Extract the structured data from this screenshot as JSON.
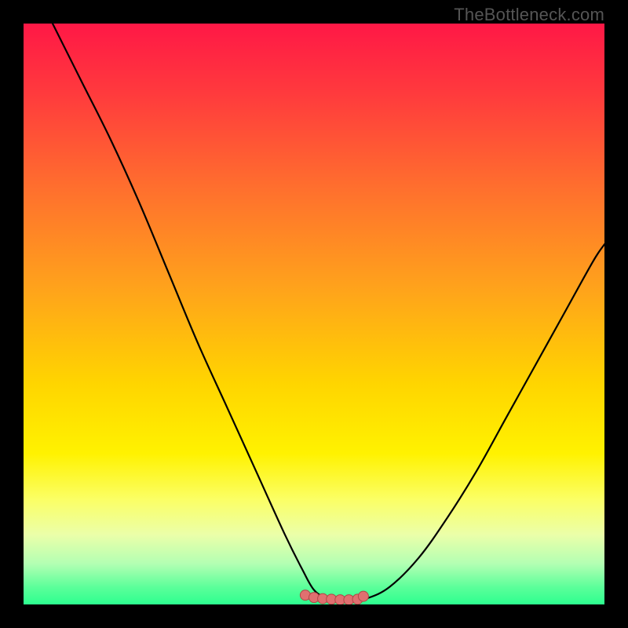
{
  "watermark": "TheBottleneck.com",
  "colors": {
    "frame": "#000000",
    "curve": "#000000",
    "marker_fill": "#e07070",
    "marker_stroke": "#b04848",
    "gradient_stops": [
      {
        "offset": 0.0,
        "color": "#ff1846"
      },
      {
        "offset": 0.12,
        "color": "#ff3a3d"
      },
      {
        "offset": 0.28,
        "color": "#ff6e2e"
      },
      {
        "offset": 0.45,
        "color": "#ffa11c"
      },
      {
        "offset": 0.62,
        "color": "#ffd500"
      },
      {
        "offset": 0.74,
        "color": "#fff200"
      },
      {
        "offset": 0.82,
        "color": "#fbff66"
      },
      {
        "offset": 0.88,
        "color": "#ebffa9"
      },
      {
        "offset": 0.93,
        "color": "#b3ffb3"
      },
      {
        "offset": 0.97,
        "color": "#5cff9a"
      },
      {
        "offset": 1.0,
        "color": "#2dff8f"
      }
    ]
  },
  "chart_data": {
    "type": "line",
    "title": "",
    "xlabel": "",
    "ylabel": "",
    "xlim": [
      0,
      100
    ],
    "ylim": [
      0,
      100
    ],
    "series": [
      {
        "name": "bottleneck-curve",
        "x": [
          5,
          10,
          15,
          20,
          25,
          30,
          35,
          40,
          45,
          48,
          50,
          52,
          55,
          57,
          59,
          63,
          68,
          73,
          78,
          83,
          88,
          93,
          98,
          100
        ],
        "y": [
          100,
          90,
          80,
          69,
          57,
          45,
          34,
          23,
          12,
          6,
          2.5,
          1.3,
          0.8,
          0.8,
          1.0,
          3.0,
          8,
          15,
          23,
          32,
          41,
          50,
          59,
          62
        ]
      }
    ],
    "markers": {
      "name": "optimal-range",
      "x": [
        48.5,
        50.0,
        51.5,
        53.0,
        54.5,
        56.0,
        57.5,
        58.5
      ],
      "y": [
        1.6,
        1.2,
        1.0,
        0.9,
        0.8,
        0.8,
        0.9,
        1.4
      ]
    }
  }
}
